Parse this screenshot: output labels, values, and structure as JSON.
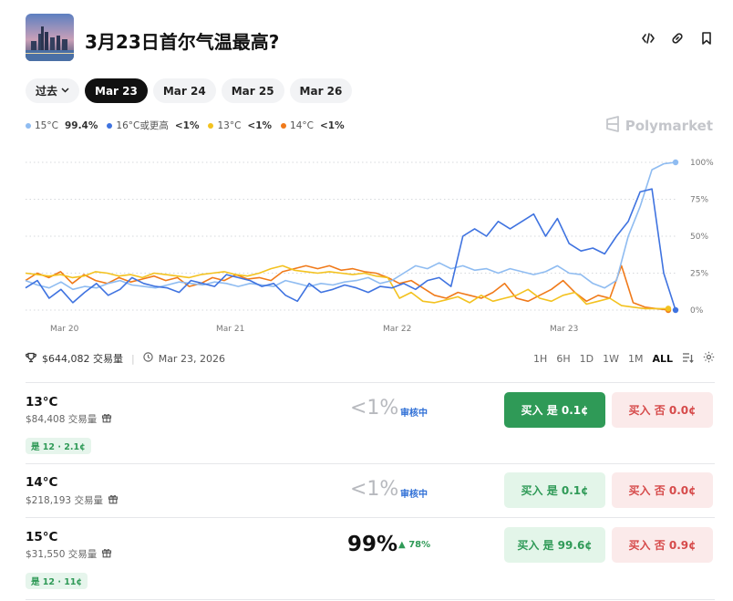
{
  "header": {
    "title": "3月23日首尔气温最高?",
    "icons": [
      "embed-code-icon",
      "link-icon",
      "bookmark-icon"
    ]
  },
  "date_filters": {
    "past_label": "过去",
    "items": [
      "Mar 23",
      "Mar 24",
      "Mar 25",
      "Mar 26"
    ],
    "active": "Mar 23"
  },
  "legend": [
    {
      "label": "15°C",
      "value": "99.4%",
      "color": "#8fbcf1"
    },
    {
      "label": "16°C或更高",
      "value": "<1%",
      "color": "#3f73e0"
    },
    {
      "label": "13°C",
      "value": "<1%",
      "color": "#f3c21f"
    },
    {
      "label": "14°C",
      "value": "<1%",
      "color": "#f07a1a"
    }
  ],
  "brand": "Polymarket",
  "chart_data": {
    "type": "line",
    "x_ticks": [
      "Mar 20",
      "Mar 21",
      "Mar 22",
      "Mar 23"
    ],
    "y_ticks": [
      "100%",
      "75%",
      "50%",
      "25%",
      "0%"
    ],
    "ylim": [
      0,
      100
    ],
    "grid": true,
    "series": [
      {
        "name": "15°C",
        "color": "#8fbcf1",
        "values": [
          20,
          17,
          15,
          19,
          14,
          16,
          15,
          18,
          20,
          17,
          16,
          15,
          17,
          19,
          18,
          17,
          19,
          18,
          16,
          18,
          17,
          16,
          20,
          18,
          16,
          18,
          17,
          19,
          20,
          22,
          18,
          20,
          25,
          30,
          28,
          32,
          28,
          30,
          27,
          28,
          25,
          28,
          26,
          24,
          26,
          30,
          25,
          24,
          18,
          15,
          20,
          50,
          70,
          95,
          99,
          100
        ]
      },
      {
        "name": "16°C或更高",
        "color": "#3f73e0",
        "values": [
          15,
          20,
          8,
          14,
          5,
          12,
          18,
          10,
          14,
          22,
          18,
          16,
          15,
          12,
          20,
          18,
          16,
          24,
          22,
          20,
          16,
          18,
          10,
          6,
          18,
          12,
          14,
          17,
          15,
          12,
          16,
          15,
          18,
          14,
          20,
          22,
          16,
          50,
          55,
          50,
          60,
          55,
          60,
          65,
          50,
          62,
          45,
          40,
          42,
          38,
          50,
          60,
          80,
          82,
          25,
          0
        ]
      },
      {
        "name": "13°C",
        "color": "#f3c21f",
        "values": [
          25,
          24,
          23,
          24,
          22,
          23,
          26,
          25,
          23,
          24,
          22,
          25,
          24,
          23,
          22,
          24,
          25,
          26,
          24,
          23,
          25,
          28,
          30,
          27,
          26,
          25,
          26,
          25,
          24,
          25,
          23,
          22,
          8,
          12,
          6,
          5,
          7,
          9,
          5,
          10,
          6,
          8,
          10,
          14,
          8,
          6,
          10,
          12,
          4,
          6,
          8,
          3,
          2,
          1,
          1,
          1
        ]
      },
      {
        "name": "14°C",
        "color": "#f07a1a",
        "values": [
          20,
          25,
          22,
          26,
          18,
          24,
          20,
          18,
          22,
          19,
          21,
          23,
          20,
          22,
          16,
          18,
          22,
          20,
          24,
          21,
          22,
          20,
          26,
          28,
          30,
          28,
          30,
          27,
          28,
          26,
          25,
          22,
          18,
          20,
          15,
          10,
          8,
          12,
          10,
          8,
          12,
          18,
          8,
          6,
          10,
          14,
          20,
          12,
          6,
          10,
          8,
          30,
          5,
          2,
          1,
          0
        ]
      }
    ]
  },
  "stats": {
    "volume": "$644,082 交易量",
    "date": "Mar 23, 2026",
    "ranges": [
      "1H",
      "6H",
      "1D",
      "1W",
      "1M",
      "ALL"
    ],
    "active_range": "ALL"
  },
  "outcomes": [
    {
      "name": "13°C",
      "volume": "$84,408 交易量",
      "badge": "是 12 · 2.1¢",
      "pct": "<1%",
      "status": "审核中",
      "yes_label": "买入 是 0.1¢",
      "no_label": "买入 否 0.0¢"
    },
    {
      "name": "14°C",
      "volume": "$218,193 交易量",
      "pct": "<1%",
      "status": "审核中",
      "yes_label": "买入 是 0.1¢",
      "no_label": "买入 否 0.0¢"
    },
    {
      "name": "15°C",
      "volume": "$31,550 交易量",
      "badge": "是 12 · 11¢",
      "pct": "99%",
      "change": "78%",
      "yes_label": "买入 是 99.6¢",
      "no_label": "买入 否 0.9¢"
    }
  ]
}
